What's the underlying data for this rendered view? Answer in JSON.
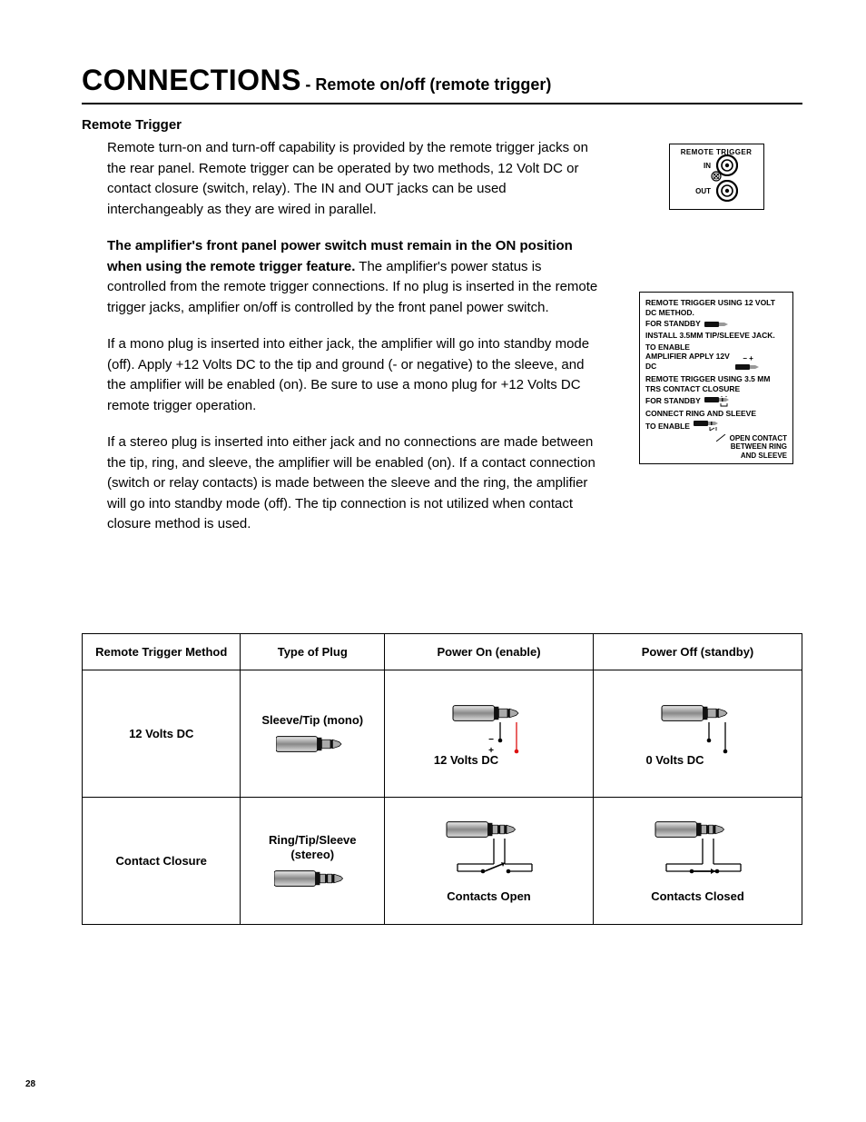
{
  "title": {
    "main": "CONNECTIONS",
    "sub": "- Remote on/off (remote trigger)"
  },
  "heading": "Remote Trigger",
  "paragraphs": {
    "p1": "Remote turn-on and turn-off capability is provided by the remote trigger jacks on the rear panel. Remote trigger can be operated by two methods, 12 Volt DC or contact closure (switch, relay). The IN and OUT jacks can be used interchangeably as they are wired in parallel.",
    "p2_bold": "The amplifier's front panel power switch must remain in the ON position when using the remote trigger feature.",
    "p2_rest": " The amplifier's power status is controlled from the remote trigger connections. If no plug is inserted in the remote trigger jacks, amplifier on/off is controlled by the front panel power switch.",
    "p3": "If a mono plug is inserted into either jack, the amplifier will go into standby mode (off). Apply +12 Volts DC to the tip and ground (- or negative) to the sleeve, and the amplifier will be enabled (on). Be sure to use a mono plug for +12 Volts DC remote trigger operation.",
    "p4": "If a stereo plug is inserted into either jack and no connections are made between the tip, ring, and sleeve, the amplifier will be enabled (on). If a contact connection (switch or relay contacts) is made between the sleeve and the ring, the amplifier will go into standby mode (off). The tip connection is not utilized when contact closure method is used."
  },
  "panel": {
    "title": "REMOTE TRIGGER",
    "in": "IN",
    "out": "OUT"
  },
  "instr": {
    "h1": "REMOTE TRIGGER USING 12 VOLT DC METHOD.",
    "r1": "FOR STANDBY",
    "r1b": "INSTALL 3.5MM TIP/SLEEVE JACK.",
    "r2": "TO ENABLE AMPLIFIER APPLY 12V DC",
    "pm": "− +",
    "h2": "REMOTE TRIGGER USING 3.5 MM TRS CONTACT CLOSURE",
    "r3": "FOR STANDBY",
    "r3b": "CONNECT RING AND SLEEVE",
    "r4": "TO ENABLE",
    "note1": "OPEN CONTACT",
    "note2": "BETWEEN RING",
    "note3": "AND SLEEVE"
  },
  "table": {
    "headers": [
      "Remote Trigger Method",
      "Type of Plug",
      "Power On (enable)",
      "Power Off (standby)"
    ],
    "rows": [
      {
        "method": "12 Volts DC",
        "plug": "Sleeve/Tip (mono)",
        "on_caption": "12 Volts DC",
        "off_caption": "0 Volts DC"
      },
      {
        "method": "Contact Closure",
        "plug": "Ring/Tip/Sleeve (stereo)",
        "on_caption": "Contacts Open",
        "off_caption": "Contacts Closed"
      }
    ]
  },
  "page_number": "28"
}
